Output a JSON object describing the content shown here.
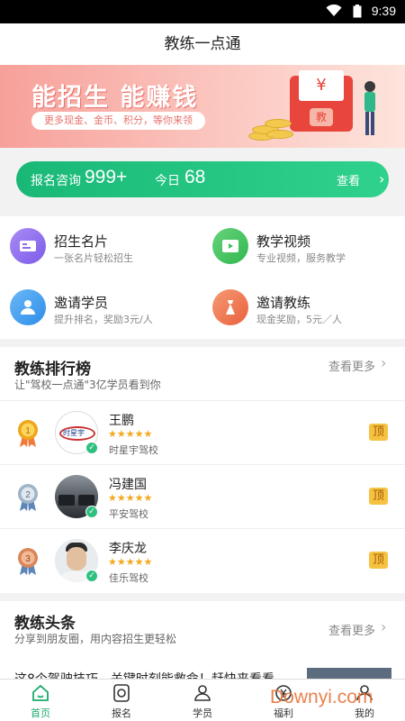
{
  "status_bar": {
    "time": "9:39"
  },
  "title": "教练一点通",
  "banner": {
    "headline": "能招生 能赚钱",
    "tagline": "更多现金、金币、积分，等你来领",
    "envelope_symbol": "¥",
    "envelope_seal": "教"
  },
  "consult": {
    "label": "报名咨询",
    "count": "999+",
    "today_label": "今日",
    "today_count": "68",
    "more": "查看"
  },
  "features": [
    {
      "title": "招生名片",
      "subtitle": "一张名片轻松招生",
      "icon": "card-icon",
      "color": "#8d6cf0"
    },
    {
      "title": "教学视频",
      "subtitle": "专业视频，服务教学",
      "icon": "video-icon",
      "color": "#3ec25e"
    },
    {
      "title": "邀请学员",
      "subtitle": "提升排名，奖励3元/人",
      "icon": "invite-student-icon",
      "color": "#3a9cf0"
    },
    {
      "title": "邀请教练",
      "subtitle": "现金奖励，5元／人",
      "icon": "invite-coach-icon",
      "color": "#f07b52"
    }
  ],
  "ranking": {
    "title": "教练排行榜",
    "subtitle": "让\"驾校一点通\"3亿学员看到你",
    "more": "查看更多",
    "coaches": [
      {
        "rank": "1",
        "name": "王鹏",
        "stars": "★★★★★",
        "school": "时星宇驾校",
        "badge": "顶",
        "avatar_text": "时星宇",
        "medal_color": "#f0a41a"
      },
      {
        "rank": "2",
        "name": "冯建国",
        "stars": "★★★★★",
        "school": "平安驾校",
        "badge": "顶",
        "medal_color": "#9fb3c8"
      },
      {
        "rank": "3",
        "name": "李庆龙",
        "stars": "★★★★★",
        "school": "佳乐驾校",
        "badge": "顶",
        "medal_color": "#d9855a"
      }
    ]
  },
  "news": {
    "title": "教练头条",
    "subtitle": "分享到朋友圈，用内容招生更轻松",
    "more": "查看更多",
    "first_headline": "这8个驾驶技巧，关键时刻能救命！赶快来看看"
  },
  "tabs": [
    {
      "label": "首页",
      "icon": "home-icon",
      "active": true
    },
    {
      "label": "报名",
      "icon": "signup-icon",
      "active": false
    },
    {
      "label": "学员",
      "icon": "students-icon",
      "active": false
    },
    {
      "label": "福利",
      "icon": "welfare-icon",
      "active": false
    },
    {
      "label": "我的",
      "icon": "profile-icon",
      "active": false
    }
  ],
  "watermark": "Downyi.com"
}
